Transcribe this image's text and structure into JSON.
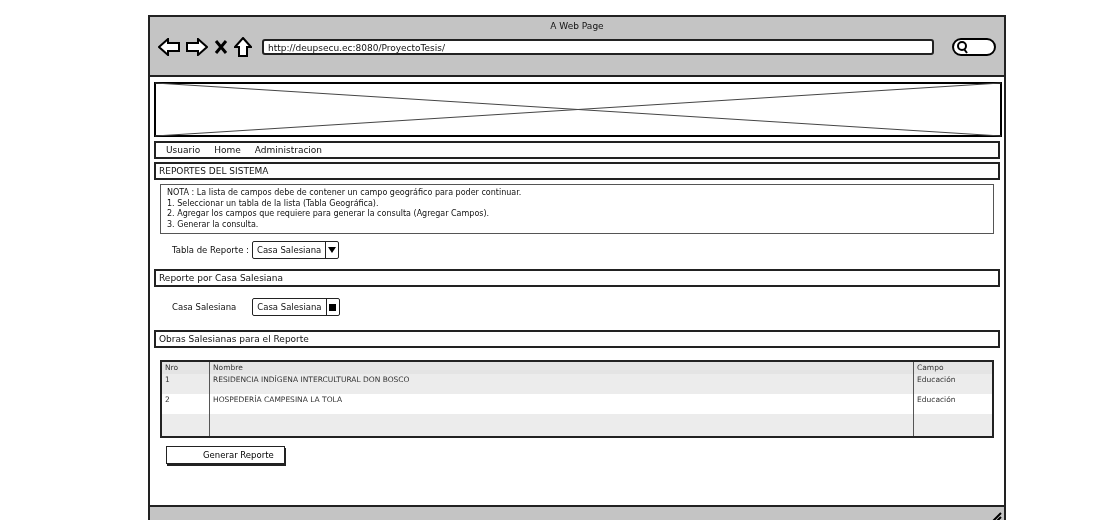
{
  "window": {
    "title": "A Web Page",
    "url": "http://deupsecu.ec:8080/ProyectoTesis/"
  },
  "menu": [
    "Usuario",
    "Home",
    "Administracion"
  ],
  "section_title": "REPORTES DEL SISTEMA",
  "note": [
    "NOTA : La lista de campos debe de contener un campo geográfico para poder continuar.",
    "1. Seleccionar un tabla de la lista (Tabla Geográfica).",
    "2. Agregar los campos que requiere para generar la consulta (Agregar Campos).",
    "3. Generar la consulta."
  ],
  "tabla_reporte": {
    "label": "Tabla de Reporte :",
    "value": "Casa Salesiana"
  },
  "casa_section": "Reporte por Casa Salesiana",
  "casa": {
    "label": "Casa Salesiana",
    "value": "Casa Salesiana"
  },
  "obras_section": "Obras Salesianas para el Reporte",
  "table": {
    "columns": [
      "Nro",
      "Nombre",
      "Campo"
    ],
    "rows": [
      [
        "1",
        "RESIDENCIA INDÍGENA INTERCULTURAL DON BOSCO",
        "Educación"
      ],
      [
        "2",
        "HOSPEDERÍA CAMPESINA LA TOLA",
        "Educación"
      ]
    ]
  },
  "button": "Generar Reporte"
}
